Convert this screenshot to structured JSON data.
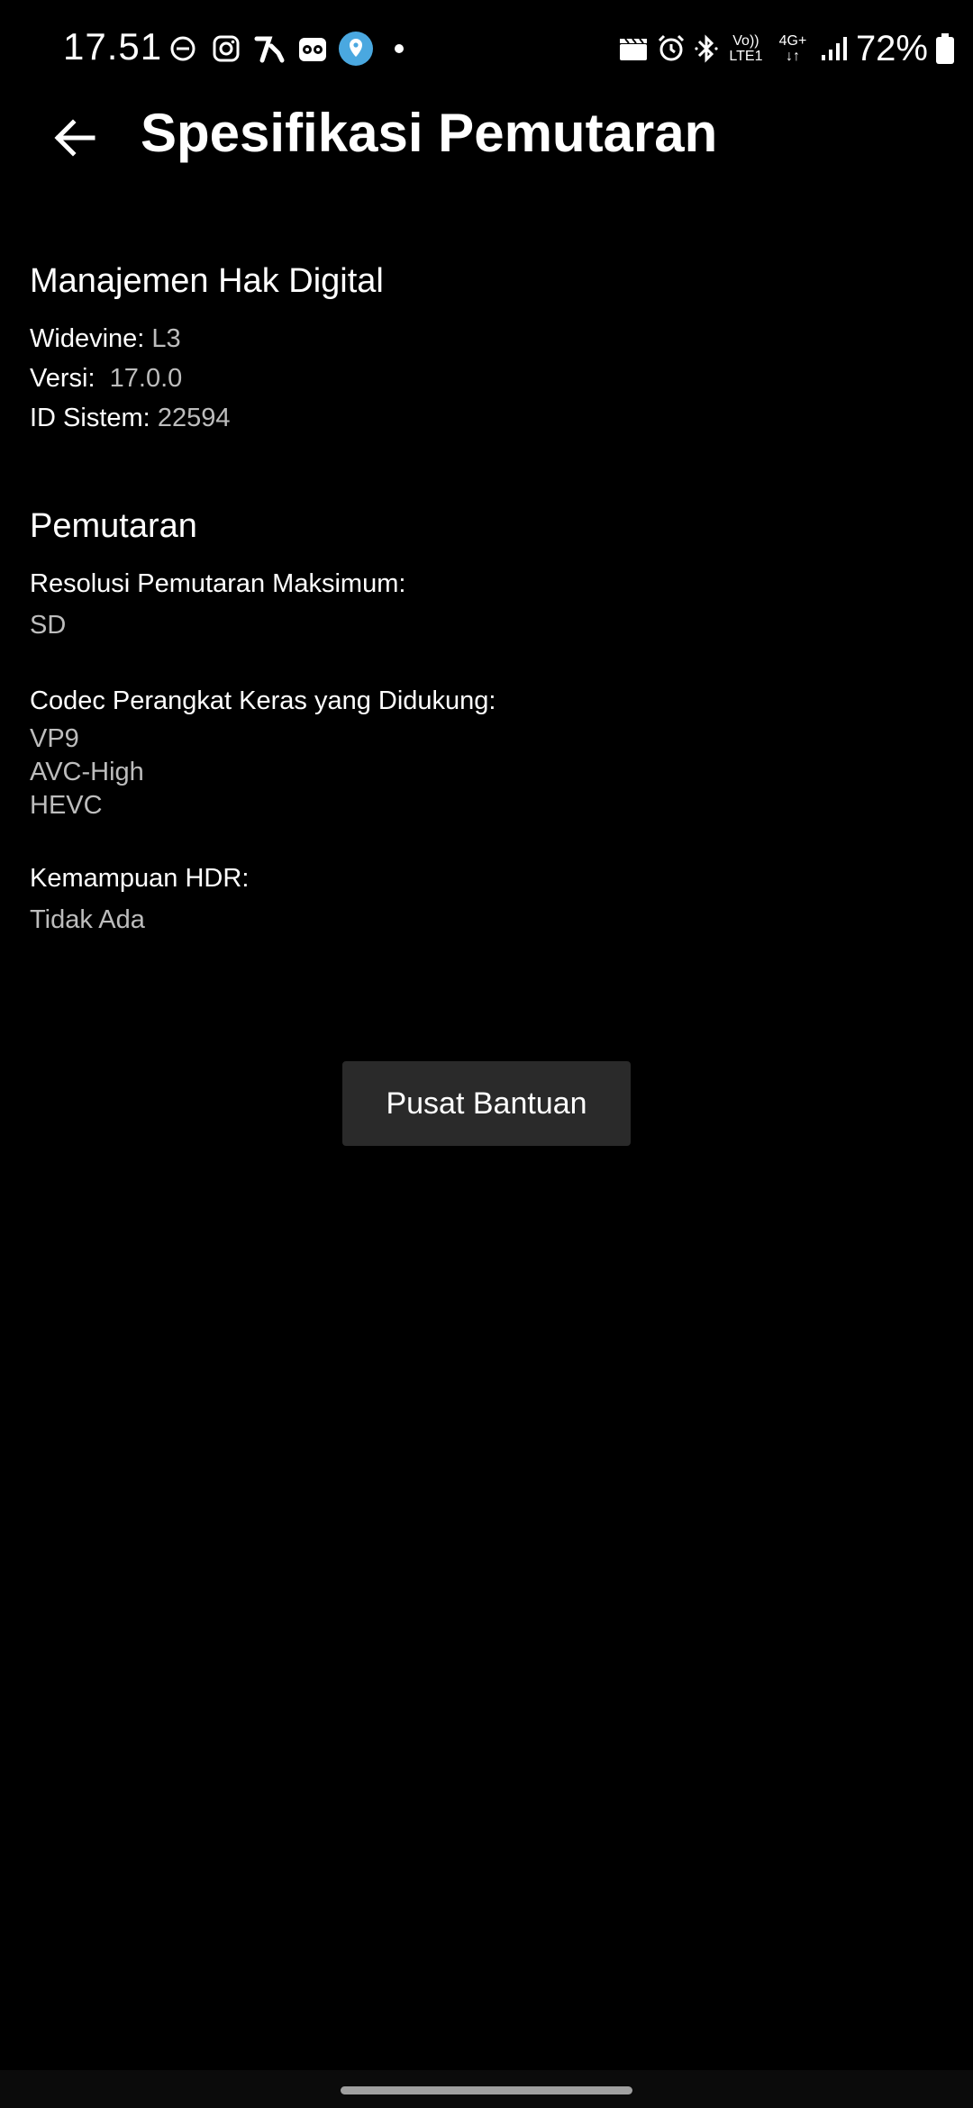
{
  "status_bar": {
    "time": "17.51",
    "battery": "72%",
    "network_top": "Vo))",
    "network_bottom": "LTE1",
    "data_top": "4G+",
    "data_bottom": "↓↑",
    "left_icons": [
      "dnd-icon",
      "instagram-icon",
      "app-icon",
      "tripadvisor-icon",
      "maps-icon",
      "dot-icon"
    ],
    "right_icons": [
      "clapperboard-icon",
      "alarm-icon",
      "bluetooth-icon",
      "signal-icon",
      "battery-icon"
    ]
  },
  "header": {
    "back_icon": "arrow-left-icon",
    "title": "Spesifikasi Pemutaran"
  },
  "drm": {
    "title": "Manajemen Hak Digital",
    "widevine_label": "Widevine:",
    "widevine_value": "L3",
    "version_label": "Versi:",
    "version_value": "17.0.0",
    "system_id_label": "ID Sistem:",
    "system_id_value": "22594"
  },
  "playback": {
    "title": "Pemutaran",
    "max_resolution_label": "Resolusi Pemutaran Maksimum:",
    "max_resolution_value": "SD",
    "codec_label": "Codec Perangkat Keras yang Didukung:",
    "codecs": [
      "VP9",
      "AVC-High",
      "HEVC"
    ],
    "hdr_label": "Kemampuan HDR:",
    "hdr_value": "Tidak Ada"
  },
  "help_button": {
    "label": "Pusat Bantuan"
  },
  "colors": {
    "background": "#000000",
    "text_primary": "#ffffff",
    "text_secondary": "#bdbdbd",
    "button_bg": "#2a2a2a"
  }
}
